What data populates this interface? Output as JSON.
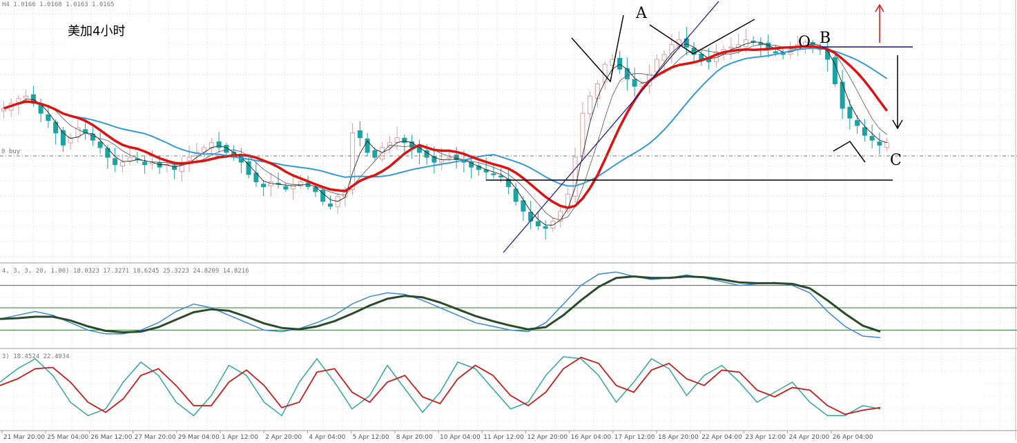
{
  "chart_data": {
    "type": "candlestick",
    "title": "美加4小时",
    "symbol_info": "H4  1.0166 1.0168 1.0163 1.0165",
    "hline_label": "9 buy",
    "stoch1_info": "4, 3, 3, 20, 1.00) 18.0323 17.3271 18.6245 25.3223 24.8209 14.8216",
    "stoch2_info": "3) 18.4524 22.4934",
    "x_labels": [
      "21 Mar 20:00",
      "25 Mar 04:00",
      "26 Mar 12:00",
      "27 Mar 20:00",
      "29 Mar 04:00",
      "1 Apr 12:00",
      "2 Apr 20:00",
      "4 Apr 04:00",
      "5 Apr 12:00",
      "8 Apr 20:00",
      "10 Apr 04:00",
      "11 Apr 12:00",
      "12 Apr 20:00",
      "16 Apr 04:00",
      "17 Apr 12:00",
      "18 Apr 20:00",
      "22 Apr 04:00",
      "23 Apr 12:00",
      "24 Apr 20:00",
      "26 Apr 04:00"
    ],
    "annotations": {
      "A": "A",
      "B": "B",
      "C": "C",
      "O": "O"
    },
    "grid": true,
    "colors": {
      "bull": "#d9a0a0",
      "bear": "#19a3a3",
      "ma_fast": "#111111",
      "ma_slow": "#555555",
      "ma_red": "#e01010",
      "ma_blue": "#3399dd",
      "trendline": "#101099",
      "stoch_main": "#3a86e0",
      "stoch_signal": "#2b4a2b",
      "stoch2_main": "#30a8a0",
      "stoch2_signal": "#cc1a1a"
    },
    "price": {
      "note": "approximate price units (arbitrary relative scale read from figure)",
      "ylim": [
        0,
        100
      ],
      "close": [
        60,
        62,
        64,
        65,
        62,
        58,
        55,
        50,
        45,
        48,
        52,
        50,
        47,
        44,
        40,
        37,
        38,
        40,
        39,
        37,
        38,
        36,
        37,
        35,
        38,
        40,
        42,
        44,
        46,
        44,
        42,
        40,
        38,
        33,
        30,
        28,
        30,
        29,
        27,
        29,
        30,
        28,
        26,
        22,
        20,
        24,
        27,
        50,
        48,
        42,
        40,
        44,
        46,
        48,
        46,
        44,
        42,
        40,
        38,
        39,
        40,
        39,
        38,
        36,
        35,
        34,
        33,
        32,
        28,
        22,
        18,
        14,
        12,
        11,
        14,
        18,
        25,
        40,
        58,
        65,
        70,
        78,
        80,
        76,
        72,
        69,
        70,
        74,
        80,
        82,
        86,
        88,
        85,
        82,
        80,
        79,
        83,
        84,
        85,
        86,
        88,
        87,
        86,
        84,
        83,
        82,
        84,
        86,
        87,
        86,
        84,
        80,
        70,
        60,
        56,
        53,
        49,
        47,
        45,
        46
      ]
    },
    "stochastic_1": {
      "ylim": [
        0,
        100
      ],
      "levels": [
        80,
        50,
        20
      ],
      "main": [
        35,
        40,
        45,
        40,
        30,
        20,
        15,
        15,
        20,
        30,
        45,
        55,
        50,
        40,
        30,
        20,
        18,
        22,
        30,
        40,
        55,
        65,
        70,
        68,
        60,
        50,
        40,
        30,
        25,
        20,
        18,
        30,
        55,
        80,
        95,
        98,
        92,
        88,
        90,
        94,
        90,
        85,
        80,
        82,
        84,
        80,
        70,
        45,
        25,
        12,
        10
      ],
      "signal": [
        35,
        36,
        38,
        38,
        33,
        25,
        19,
        17,
        18,
        24,
        34,
        44,
        48,
        46,
        38,
        29,
        23,
        21,
        25,
        32,
        42,
        53,
        62,
        66,
        64,
        57,
        48,
        39,
        32,
        26,
        21,
        24,
        40,
        60,
        78,
        90,
        92,
        90,
        90,
        92,
        91,
        88,
        84,
        83,
        83,
        82,
        76,
        60,
        42,
        26,
        18
      ]
    },
    "stochastic_2": {
      "ylim": [
        0,
        100
      ],
      "main": [
        60,
        80,
        95,
        70,
        30,
        10,
        20,
        60,
        90,
        70,
        30,
        10,
        40,
        85,
        70,
        30,
        10,
        60,
        95,
        60,
        20,
        40,
        85,
        50,
        15,
        45,
        90,
        80,
        50,
        20,
        30,
        70,
        98,
        95,
        70,
        30,
        60,
        95,
        80,
        40,
        70,
        85,
        60,
        30,
        45,
        60,
        30,
        10,
        10,
        25,
        20
      ],
      "signal": [
        55,
        65,
        80,
        82,
        60,
        30,
        15,
        35,
        70,
        80,
        55,
        25,
        25,
        60,
        78,
        55,
        22,
        30,
        75,
        80,
        45,
        30,
        60,
        70,
        38,
        28,
        65,
        85,
        70,
        40,
        25,
        45,
        80,
        97,
        88,
        55,
        45,
        78,
        88,
        65,
        55,
        78,
        75,
        48,
        38,
        52,
        48,
        25,
        12,
        18,
        22
      ]
    }
  }
}
